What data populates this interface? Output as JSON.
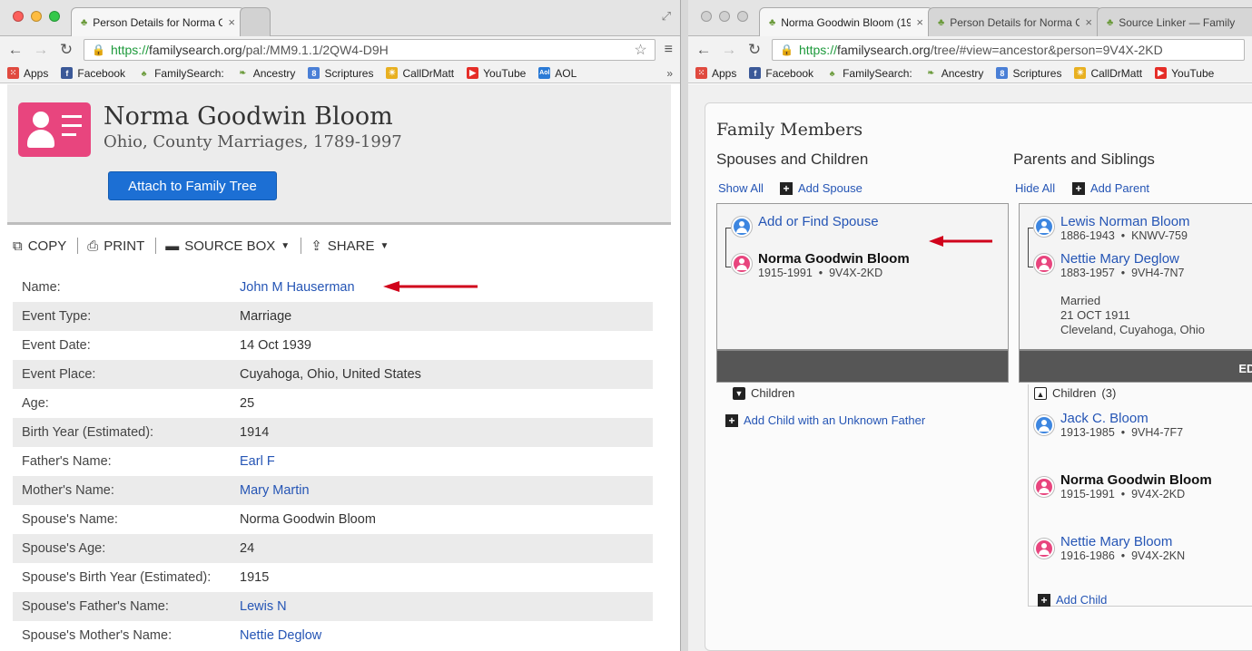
{
  "left_window": {
    "tabs": [
      {
        "label": "Person Details for Norma C",
        "active": true
      },
      {
        "label": "",
        "active": false
      }
    ],
    "url": {
      "scheme": "https://",
      "host": "familysearch.org",
      "path": "/pal:/MM9.1.1/2QW4-D9H"
    },
    "bookmarks": [
      "Apps",
      "Facebook",
      "FamilySearch:",
      "Ancestry",
      "Scriptures",
      "CallDrMatt",
      "YouTube",
      "AOL"
    ],
    "bookmarks_more": "»",
    "person": {
      "name": "Norma Goodwin Bloom",
      "collection": "Ohio, County Marriages, 1789-1997",
      "attach_button": "Attach to Family Tree"
    },
    "actions": [
      "COPY",
      "PRINT",
      "SOURCE BOX",
      "SHARE"
    ],
    "fields": [
      {
        "label": "Name:",
        "value": "John M Hauserman",
        "link": true
      },
      {
        "label": "Event Type:",
        "value": "Marriage",
        "link": false
      },
      {
        "label": "Event Date:",
        "value": "14 Oct 1939",
        "link": false
      },
      {
        "label": "Event Place:",
        "value": "Cuyahoga, Ohio, United States",
        "link": false
      },
      {
        "label": "Age:",
        "value": "25",
        "link": false
      },
      {
        "label": "Birth Year (Estimated):",
        "value": "1914",
        "link": false
      },
      {
        "label": "Father's Name:",
        "value": "Earl F",
        "link": true
      },
      {
        "label": "Mother's Name:",
        "value": "Mary Martin",
        "link": true
      },
      {
        "label": "Spouse's Name:",
        "value": "Norma Goodwin Bloom",
        "link": false
      },
      {
        "label": "Spouse's Age:",
        "value": "24",
        "link": false
      },
      {
        "label": "Spouse's Birth Year (Estimated):",
        "value": "1915",
        "link": false
      },
      {
        "label": "Spouse's Father's Name:",
        "value": "Lewis N",
        "link": true
      },
      {
        "label": "Spouse's Mother's Name:",
        "value": "Nettie Deglow",
        "link": true
      }
    ]
  },
  "right_window": {
    "tabs": [
      {
        "label": "Norma Goodwin Bloom (19",
        "active": true
      },
      {
        "label": "Person Details for Norma C",
        "active": false
      },
      {
        "label": "Source Linker — Family",
        "active": false
      }
    ],
    "url": {
      "scheme": "https://",
      "host": "familysearch.org",
      "path": "/tree/#view=ancestor&person=9V4X-2KD"
    },
    "bookmarks": [
      "Apps",
      "Facebook",
      "FamilySearch:",
      "Ancestry",
      "Scriptures",
      "CallDrMatt",
      "YouTube"
    ],
    "family": {
      "title": "Family Members",
      "spouses_title": "Spouses and Children",
      "parents_title": "Parents and Siblings",
      "show_all": "Show All",
      "add_spouse": "Add Spouse",
      "hide_all": "Hide All",
      "add_parent": "Add Parent",
      "add_find_spouse": "Add or Find Spouse",
      "self": {
        "name": "Norma Goodwin Bloom",
        "years": "1915-1991",
        "id": "9V4X-2KD"
      },
      "children_label": "Children",
      "add_child_unknown": "Add Child with an Unknown Father",
      "father": {
        "name": "Lewis Norman Bloom",
        "years": "1886-1943",
        "id": "KNWV-759"
      },
      "mother": {
        "name": "Nettie Mary Deglow",
        "years": "1883-1957",
        "id": "9VH4-7N7"
      },
      "marriage": {
        "label": "Married",
        "date": "21 OCT 1911",
        "place": "Cleveland, Cuyahoga, Ohio"
      },
      "edit": "EDIT",
      "siblings_label": "Children",
      "siblings_count": "(3)",
      "siblings": [
        {
          "name": "Jack C. Bloom",
          "years": "1913-1985",
          "id": "9VH4-7F7"
        },
        {
          "name": "Norma Goodwin Bloom",
          "years": "1915-1991",
          "id": "9V4X-2KD"
        },
        {
          "name": "Nettie Mary Bloom",
          "years": "1916-1986",
          "id": "9V4X-2KN"
        }
      ],
      "add_child": "Add Child"
    }
  },
  "colors": {
    "link": "#2555b5",
    "attach_button": "#1c6fd4",
    "female": "#e8457e",
    "male": "#3d86e0",
    "arrow": "#d0021b"
  }
}
